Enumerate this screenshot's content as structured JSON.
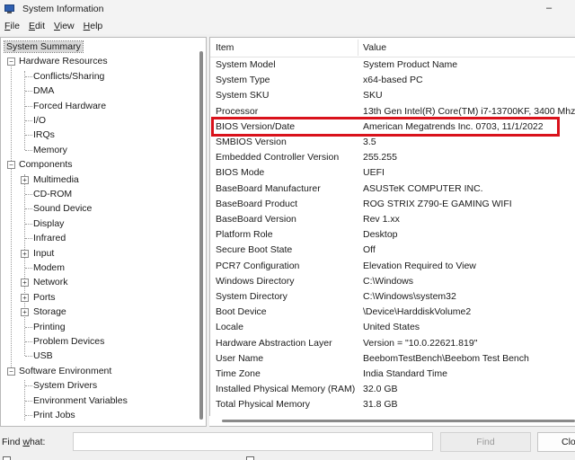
{
  "window": {
    "title": "System Information"
  },
  "menu": [
    {
      "label": "File",
      "accel": "F",
      "rest": "ile"
    },
    {
      "label": "Edit",
      "accel": "E",
      "rest": "dit"
    },
    {
      "label": "View",
      "accel": "V",
      "rest": "iew"
    },
    {
      "label": "Help",
      "accel": "H",
      "rest": "elp"
    }
  ],
  "tree": {
    "items": [
      {
        "label": "System Summary",
        "selected": true
      },
      {
        "label": "Hardware Resources",
        "expander": "−"
      },
      {
        "label": "Conflicts/Sharing"
      },
      {
        "label": "DMA"
      },
      {
        "label": "Forced Hardware"
      },
      {
        "label": "I/O"
      },
      {
        "label": "IRQs"
      },
      {
        "label": "Memory"
      },
      {
        "label": "Components",
        "expander": "−"
      },
      {
        "label": "Multimedia",
        "expander": "+"
      },
      {
        "label": "CD-ROM"
      },
      {
        "label": "Sound Device"
      },
      {
        "label": "Display"
      },
      {
        "label": "Infrared"
      },
      {
        "label": "Input",
        "expander": "+"
      },
      {
        "label": "Modem"
      },
      {
        "label": "Network",
        "expander": "+"
      },
      {
        "label": "Ports",
        "expander": "+"
      },
      {
        "label": "Storage",
        "expander": "+"
      },
      {
        "label": "Printing"
      },
      {
        "label": "Problem Devices"
      },
      {
        "label": "USB"
      },
      {
        "label": "Software Environment",
        "expander": "−"
      },
      {
        "label": "System Drivers"
      },
      {
        "label": "Environment Variables"
      },
      {
        "label": "Print Jobs"
      }
    ]
  },
  "table": {
    "columns": [
      "Item",
      "Value"
    ],
    "rows": [
      [
        "System Model",
        "System Product Name"
      ],
      [
        "System Type",
        "x64-based PC"
      ],
      [
        "System SKU",
        "SKU"
      ],
      [
        "Processor",
        "13th Gen Intel(R) Core(TM) i7-13700KF, 3400 Mhz,"
      ],
      [
        "BIOS Version/Date",
        "American Megatrends Inc. 0703, 11/1/2022"
      ],
      [
        "SMBIOS Version",
        "3.5"
      ],
      [
        "Embedded Controller Version",
        "255.255"
      ],
      [
        "BIOS Mode",
        "UEFI"
      ],
      [
        "BaseBoard Manufacturer",
        "ASUSTeK COMPUTER INC."
      ],
      [
        "BaseBoard Product",
        "ROG STRIX Z790-E GAMING WIFI"
      ],
      [
        "BaseBoard Version",
        "Rev 1.xx"
      ],
      [
        "Platform Role",
        "Desktop"
      ],
      [
        "Secure Boot State",
        "Off"
      ],
      [
        "PCR7 Configuration",
        "Elevation Required to View"
      ],
      [
        "Windows Directory",
        "C:\\Windows"
      ],
      [
        "System Directory",
        "C:\\Windows\\system32"
      ],
      [
        "Boot Device",
        "\\Device\\HarddiskVolume2"
      ],
      [
        "Locale",
        "United States"
      ],
      [
        "Hardware Abstraction Layer",
        "Version = \"10.0.22621.819\""
      ],
      [
        "User Name",
        "BeebomTestBench\\Beebom Test Bench"
      ],
      [
        "Time Zone",
        "India Standard Time"
      ],
      [
        "Installed Physical Memory (RAM)",
        "32.0 GB"
      ],
      [
        "Total Physical Memory",
        "31.8 GB"
      ]
    ]
  },
  "highlight_color": "#d9121b",
  "find": {
    "label_pre": "Find ",
    "label_accel": "w",
    "label_post": "hat:",
    "input_value": "",
    "find_button": "Find",
    "close_button": "Clo"
  }
}
